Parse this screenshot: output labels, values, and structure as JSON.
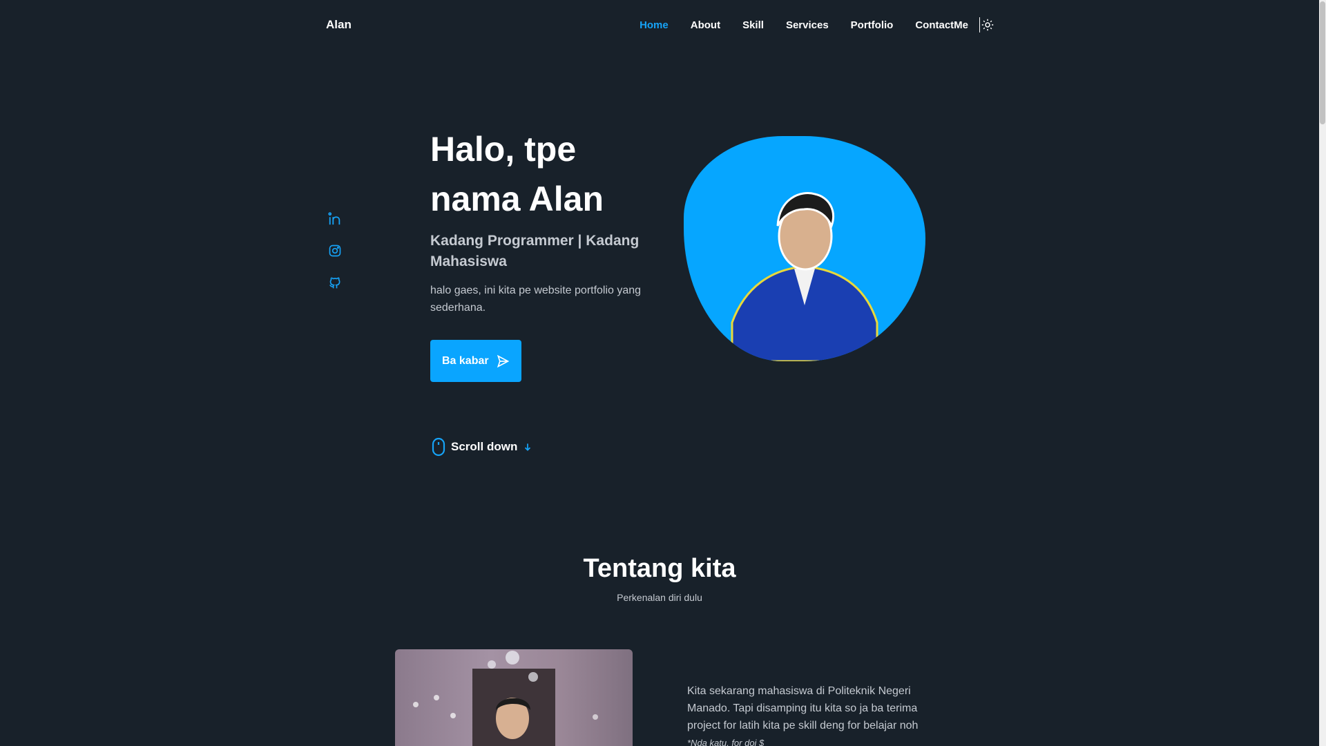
{
  "header": {
    "logo": "Alan",
    "nav": [
      "Home",
      "About",
      "Skill",
      "Services",
      "Portfolio",
      "ContactMe"
    ],
    "active_nav": "Home"
  },
  "hero": {
    "title_line1": "Halo, tpe",
    "title_line2": "nama Alan",
    "subtitle": "Kadang Programmer | Kadang Mahasiswa",
    "description": "halo gaes, ini kita pe website portfolio yang sederhana.",
    "button_label": "Ba kabar",
    "scroll_label": "Scroll down"
  },
  "social": [
    "linkedin-icon",
    "instagram-icon",
    "github-icon"
  ],
  "about": {
    "title": "Tentang kita",
    "subtitle": "Perkenalan diri dulu",
    "text": "Kita sekarang mahasiswa di Politeknik Negeri Manado. Tapi disamping itu kita so ja ba terima project for latih kita pe skill deng for belajar noh",
    "note": "*Nda katu, for doi $"
  },
  "colors": {
    "background": "#18212a",
    "accent": "#0aa5ff",
    "text": "#ffffff",
    "muted": "#c5cad1"
  }
}
